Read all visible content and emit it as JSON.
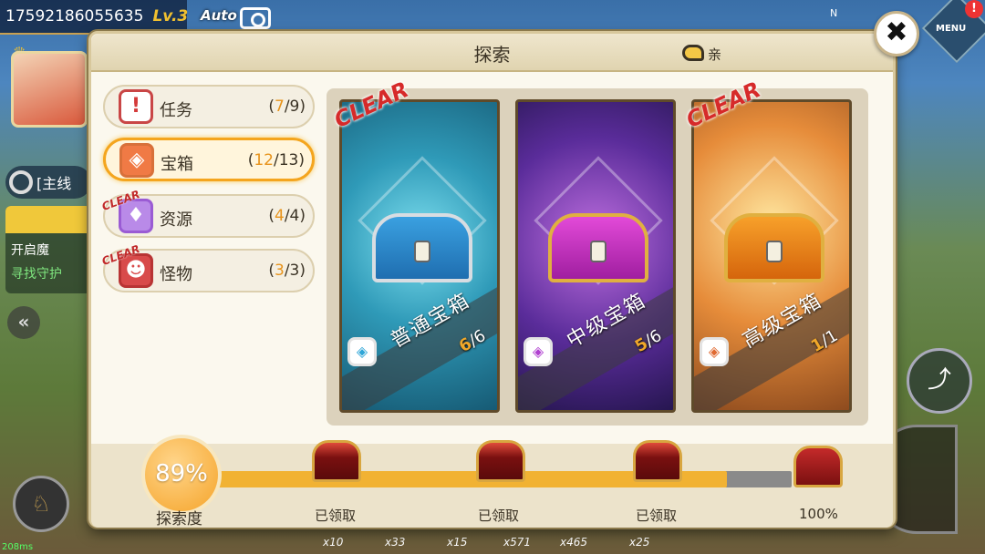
{
  "hud": {
    "player_id": "17592186055635",
    "level": "Lv.3",
    "auto_label": "Auto",
    "quest_tag": "[主线",
    "quest_line1": "开启魔",
    "quest_line2": "寻找守护",
    "menu_label": "MENU",
    "menu_badge": "!",
    "compass_n": "N",
    "ping": "208ms",
    "hotbar": [
      "x10",
      "x33",
      "x15",
      "x571",
      "x465",
      "x25"
    ]
  },
  "dialog": {
    "title": "探索",
    "hint_text": "亲",
    "close_label": "✖"
  },
  "tabs": [
    {
      "label": "任务",
      "done": "7",
      "total": "/9)",
      "open": "(",
      "clear": ""
    },
    {
      "label": "宝箱",
      "done": "12",
      "total": "/13)",
      "open": "(",
      "clear": ""
    },
    {
      "label": "资源",
      "done": "4",
      "total": "/4)",
      "open": "(",
      "clear": "CLEAR"
    },
    {
      "label": "怪物",
      "done": "3",
      "total": "/3)",
      "open": "(",
      "clear": "CLEAR"
    }
  ],
  "cards": [
    {
      "name": "普通宝箱",
      "done": "6",
      "total": "/6",
      "clear": "CLEAR"
    },
    {
      "name": "中级宝箱",
      "done": "5",
      "total": "/6",
      "clear": ""
    },
    {
      "name": "高级宝箱",
      "done": "1",
      "total": "/1",
      "clear": "CLEAR"
    }
  ],
  "progress": {
    "percent_text": "89%",
    "percent_value": 0.89,
    "label": "探索度",
    "milestones": [
      "已领取",
      "已领取",
      "已领取",
      "100%"
    ]
  },
  "colors": {
    "accent": "#f1b233",
    "clear_red": "#d62a2a",
    "count_orange": "#e7931b"
  }
}
